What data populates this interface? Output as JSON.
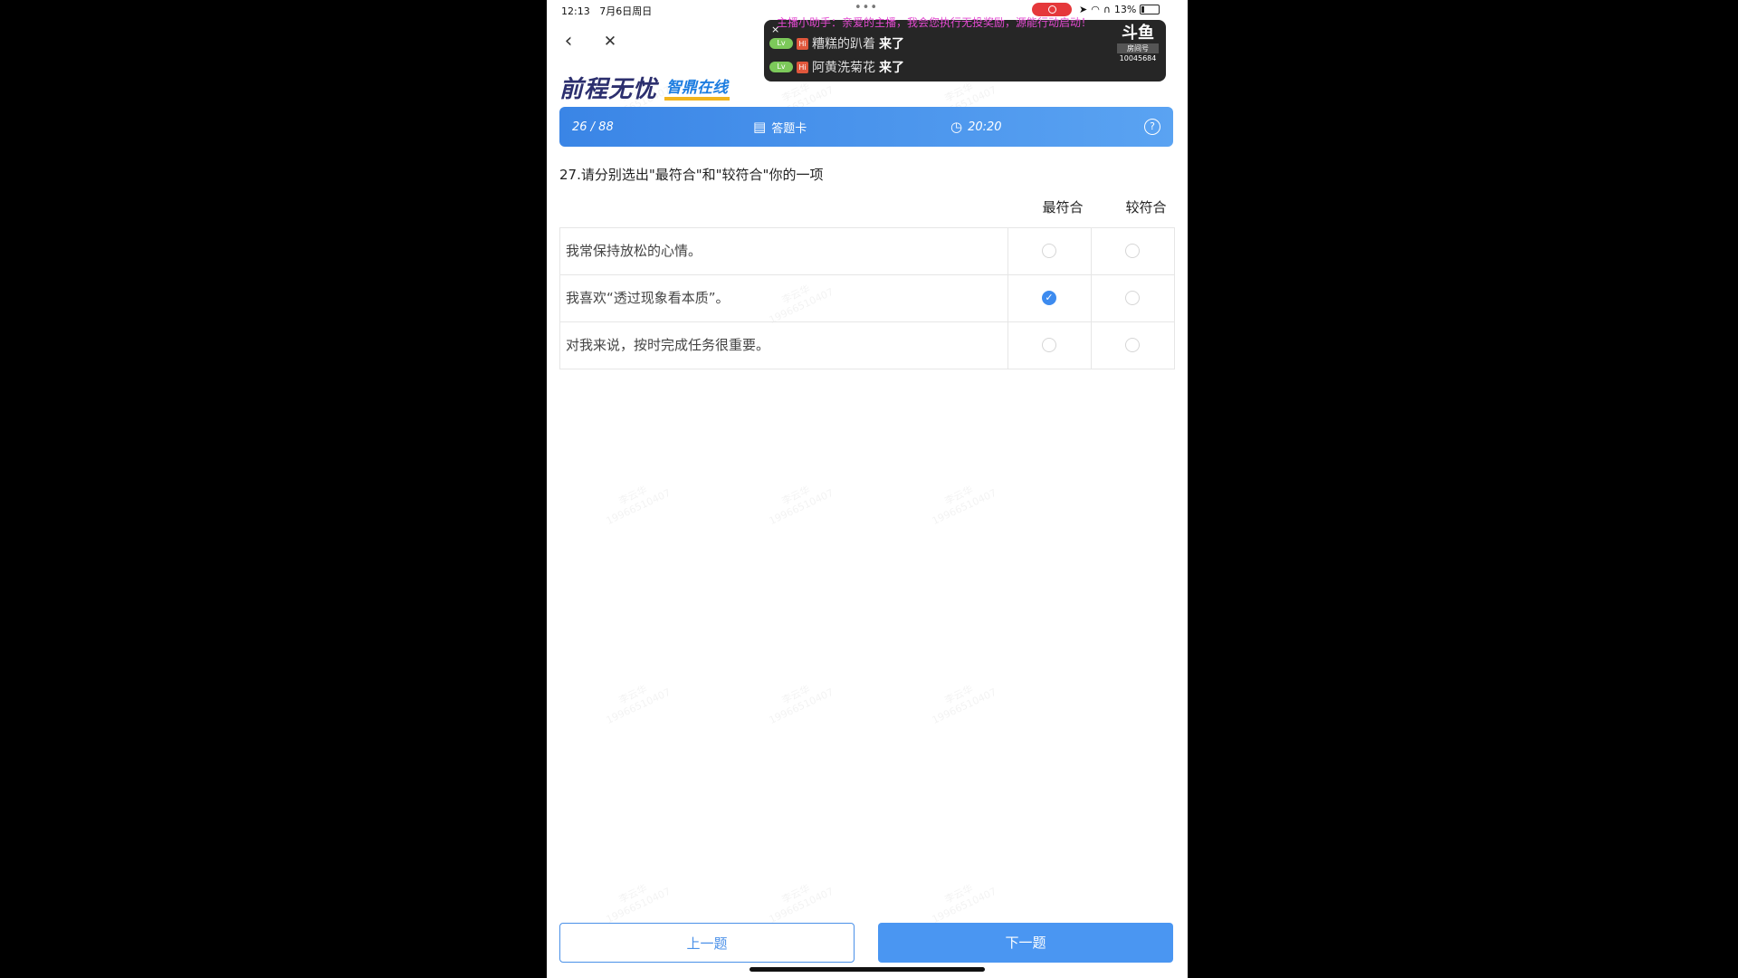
{
  "status": {
    "time": "12:13",
    "date": "7月6日周日",
    "dots": "•••",
    "battery": "13%"
  },
  "live_overlay": {
    "ticker": "主播小助手：亲爱的主播，我会您执行无投奖励，源能行动启动！",
    "close": "×",
    "entries": [
      {
        "badge": "Lv",
        "hi": "Hi",
        "name": "糟糕的趴着",
        "action": "来了"
      },
      {
        "badge": "Lv",
        "hi": "Hi",
        "name": "阿黄洗菊花",
        "action": "来了"
      }
    ],
    "room_logo": "斗鱼",
    "room_label": "房间号",
    "room_number": "10045684"
  },
  "nav": {
    "back": "‹",
    "close": "✕"
  },
  "logo": {
    "main": "前程无忧",
    "sub": "智鼎在线"
  },
  "quiz_bar": {
    "progress": "26 / 88",
    "answer_card_icon": "▤",
    "answer_card": "答题卡",
    "timer_icon": "◷",
    "timer": "20:20",
    "help": "?"
  },
  "question": {
    "text": "27.请分别选出\"最符合\"和\"较符合\"你的一项"
  },
  "columns": {
    "most": "最符合",
    "more": "较符合"
  },
  "options": [
    {
      "text": "我常保持放松的心情。",
      "most_checked": false,
      "more_checked": false
    },
    {
      "text": "我喜欢“透过现象看本质”。",
      "most_checked": true,
      "more_checked": false
    },
    {
      "text": "对我来说，按时完成任务很重要。",
      "most_checked": false,
      "more_checked": false
    }
  ],
  "check_mark": "✓",
  "buttons": {
    "prev": "上一题",
    "next": "下一题"
  },
  "watermark": {
    "name": "李云华",
    "phone": "19966510407"
  },
  "colors": {
    "accent": "#4a96f2",
    "logo": "#2c2f6e"
  }
}
